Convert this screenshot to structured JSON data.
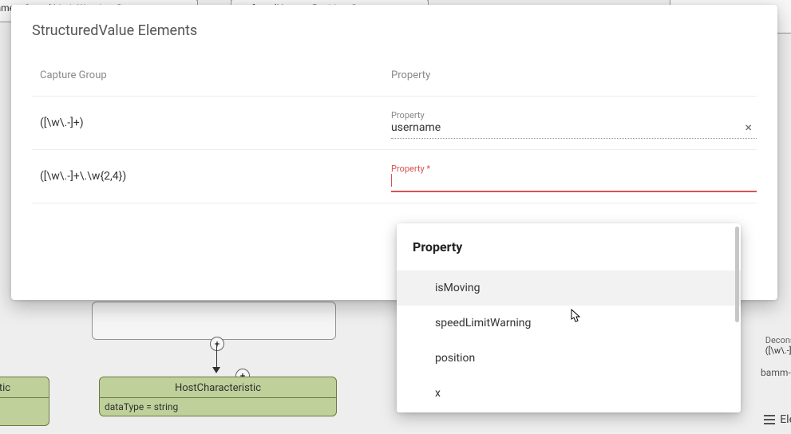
{
  "modal": {
    "title": "StructuredValue Elements",
    "columns": {
      "capture": "Capture Group",
      "property": "Property"
    },
    "rows": [
      {
        "capture": "([\\w\\.-]+)",
        "field_label": "Property",
        "value": "username",
        "required": false
      },
      {
        "capture": "([\\w\\.-]+\\.\\w{2,4})",
        "field_label": "Property *",
        "value": "",
        "required": true
      }
    ]
  },
  "dropdown": {
    "header": "Property",
    "options": [
      {
        "label": "isMoving",
        "hover": true
      },
      {
        "label": "speedLimitWarning",
        "hover": false
      },
      {
        "label": "position",
        "hover": false
      },
      {
        "label": "x",
        "hover": false
      }
    ]
  },
  "background": {
    "top_left_box": "redName = Speed Limit Warning @en",
    "top_mid_box": "preferredName = Position @en",
    "host_box_title": "HostCharacteristic",
    "host_box_sub": "dataType = string",
    "istic_box": "istic",
    "decon_label": "Deconstructi",
    "decon_value": "([\\w\\.-]+)@",
    "bamm": "bamm-c:de",
    "ele": "Ele"
  },
  "icons": {
    "clear": "×",
    "plus": "+"
  }
}
